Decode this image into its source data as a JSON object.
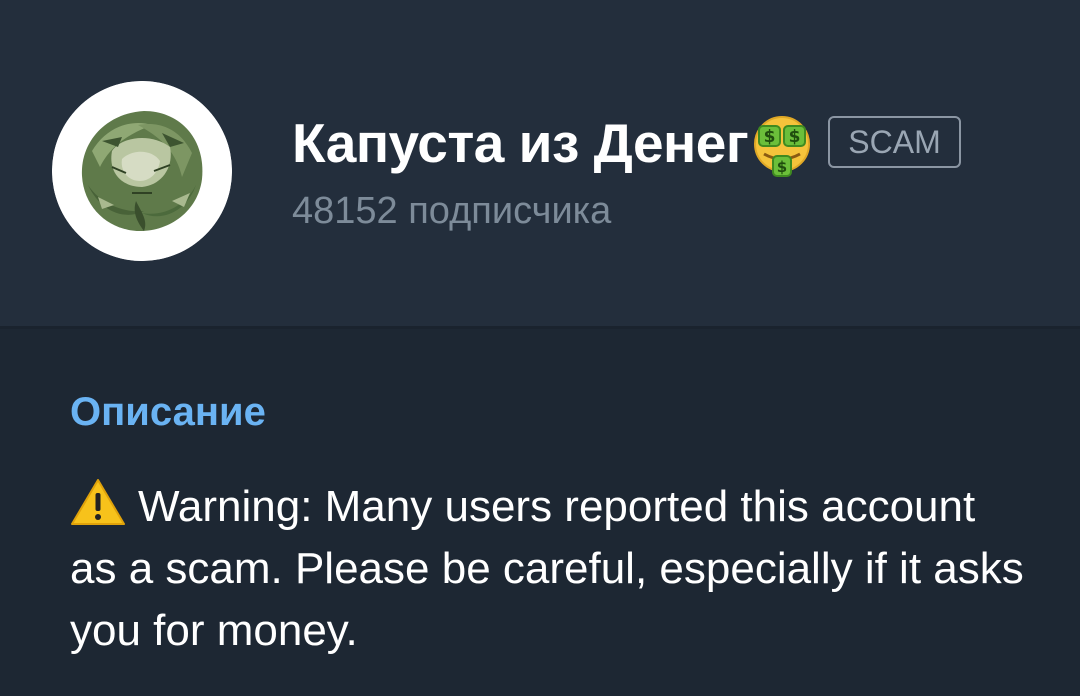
{
  "channel": {
    "name": "Капуста из Денег",
    "emoji": "money-mouth-face-icon",
    "badge": "SCAM",
    "subscribers": "48152 подписчика"
  },
  "description": {
    "title": "Описание",
    "warning_icon": "warning-icon",
    "text": "Warning: Many users reported this account as a scam. Please be careful, especially if it asks you for money."
  },
  "colors": {
    "header_bg": "#232e3c",
    "body_bg": "#1d2733",
    "accent": "#6ab3f3",
    "muted": "#7d8b99"
  }
}
